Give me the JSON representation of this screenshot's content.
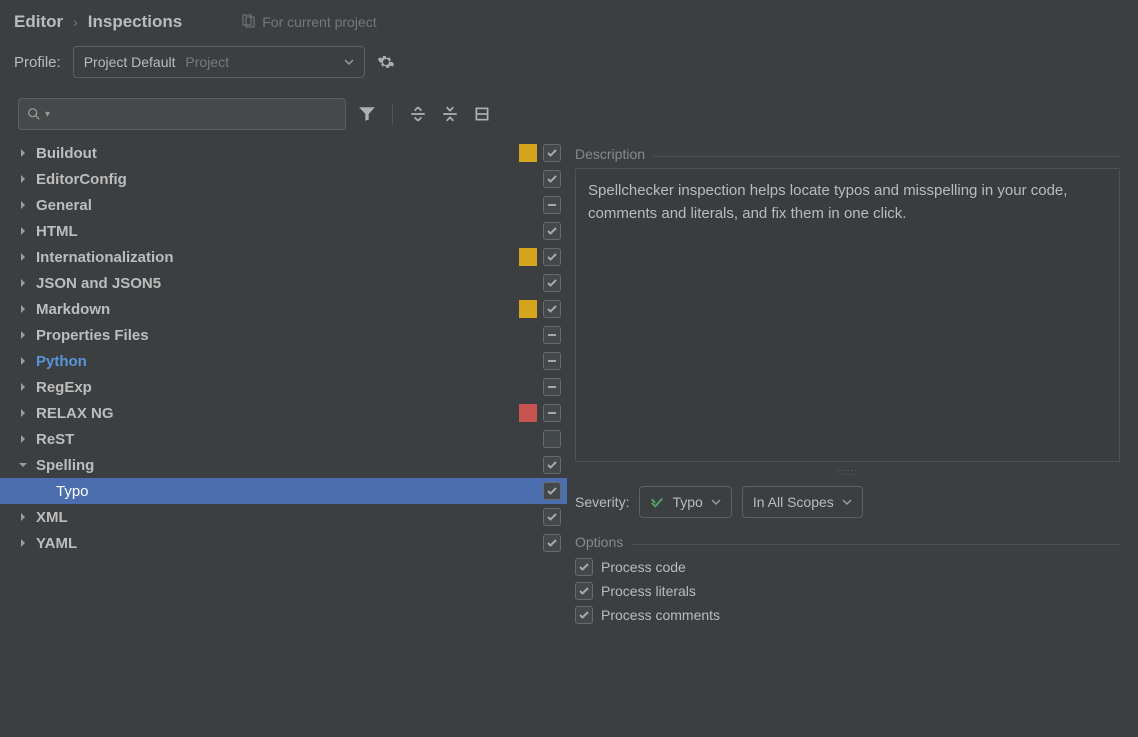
{
  "breadcrumb": {
    "a": "Editor",
    "b": "Inspections"
  },
  "scope_label": "For current project",
  "profile": {
    "label": "Profile:",
    "value": "Project Default",
    "aux": "Project"
  },
  "search": {
    "placeholder": ""
  },
  "tree": [
    {
      "name": "Buildout",
      "expanded": false,
      "children": [],
      "severity": "warn",
      "check": "on"
    },
    {
      "name": "EditorConfig",
      "expanded": false,
      "children": [],
      "severity": null,
      "check": "on"
    },
    {
      "name": "General",
      "expanded": false,
      "children": [],
      "severity": null,
      "check": "mix"
    },
    {
      "name": "HTML",
      "expanded": false,
      "children": [],
      "severity": null,
      "check": "on"
    },
    {
      "name": "Internationalization",
      "expanded": false,
      "children": [],
      "severity": "warn",
      "check": "on"
    },
    {
      "name": "JSON and JSON5",
      "expanded": false,
      "children": [],
      "severity": null,
      "check": "on"
    },
    {
      "name": "Markdown",
      "expanded": false,
      "children": [],
      "severity": "warn",
      "check": "on"
    },
    {
      "name": "Properties Files",
      "expanded": false,
      "children": [],
      "severity": null,
      "check": "mix"
    },
    {
      "name": "Python",
      "expanded": false,
      "children": [],
      "severity": null,
      "check": "mix",
      "hl": "py"
    },
    {
      "name": "RegExp",
      "expanded": false,
      "children": [],
      "severity": null,
      "check": "mix"
    },
    {
      "name": "RELAX NG",
      "expanded": false,
      "children": [],
      "severity": "err",
      "check": "mix"
    },
    {
      "name": "ReST",
      "expanded": false,
      "children": [],
      "severity": null,
      "check": "off"
    },
    {
      "name": "Spelling",
      "expanded": true,
      "children": [
        {
          "name": "Typo",
          "check": "on",
          "selected": true
        }
      ],
      "severity": null,
      "check": "on"
    },
    {
      "name": "XML",
      "expanded": false,
      "children": [],
      "severity": null,
      "check": "on"
    },
    {
      "name": "YAML",
      "expanded": false,
      "children": [],
      "severity": null,
      "check": "on"
    }
  ],
  "description": {
    "title": "Description",
    "text": "Spellchecker inspection helps locate typos and misspelling in your code, comments and literals, and fix them in one click."
  },
  "severity": {
    "label": "Severity:",
    "value": "Typo",
    "scope": "In All Scopes"
  },
  "options": {
    "title": "Options",
    "items": [
      {
        "label": "Process code",
        "checked": true
      },
      {
        "label": "Process literals",
        "checked": true
      },
      {
        "label": "Process comments",
        "checked": true
      }
    ]
  }
}
